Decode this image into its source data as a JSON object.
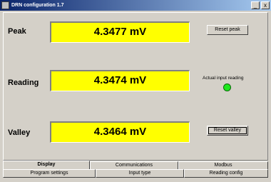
{
  "window": {
    "title": "DRN configuration 1.7",
    "min": "_",
    "close": "x"
  },
  "rows": {
    "peak": {
      "label": "Peak",
      "value": "4.3477  mV",
      "button": "Reset peak"
    },
    "reading": {
      "label": "Reading",
      "value": "4.3474 mV",
      "actual_label": "Actual input reading",
      "led_color": "#1ee81e"
    },
    "valley": {
      "label": "Valley",
      "value": "4.3464  mV",
      "button": "Reset valley"
    }
  },
  "tabs_row1": [
    "Display",
    "Communications",
    "Modbus"
  ],
  "tabs_row2": [
    "Program settings",
    "Input type",
    "Reading config"
  ]
}
